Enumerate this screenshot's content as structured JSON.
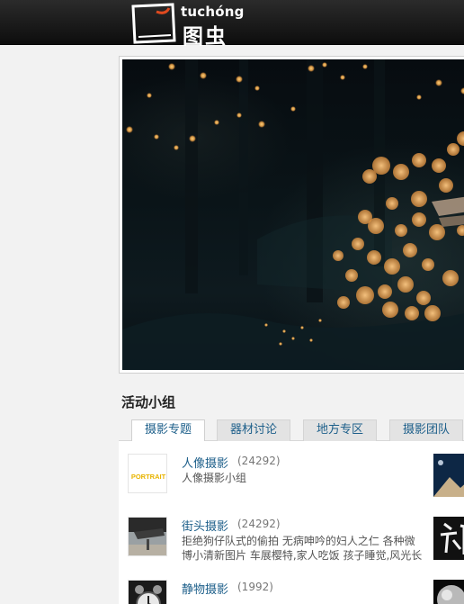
{
  "header": {
    "logo_text": "tuchóng",
    "logo_cn": "图虫",
    "logo_icon": "tuchong-frame-logo"
  },
  "hero": {
    "image_desc_icon": "forest-fireflies-photo"
  },
  "groups_section": {
    "title": "活动小组",
    "tabs": [
      {
        "label": "摄影专题",
        "active": true
      },
      {
        "label": "器材讨论",
        "active": false
      },
      {
        "label": "地方专区",
        "active": false
      },
      {
        "label": "摄影团队",
        "active": false
      }
    ],
    "items": [
      {
        "name": "人像摄影",
        "count": "(24292)",
        "desc": "人像摄影小组",
        "thumb_text": "PORTRAIT"
      },
      {
        "name": "街头摄影",
        "count": "(24292)",
        "desc": "拒绝狗仔队式的偷拍 无病呻吟的妇人之仁 各种微博小清新图片 车展樱特,家人吃饭 孩子睡觉,风光长",
        "thumb_text": ""
      },
      {
        "name": "静物摄影",
        "count": "(1992)",
        "desc": "",
        "thumb_text": ""
      }
    ]
  },
  "colors": {
    "link": "#1d5f8a",
    "bg": "#f2f2f2",
    "topbar": "#111111",
    "logo_accent": "#e04a1f"
  }
}
